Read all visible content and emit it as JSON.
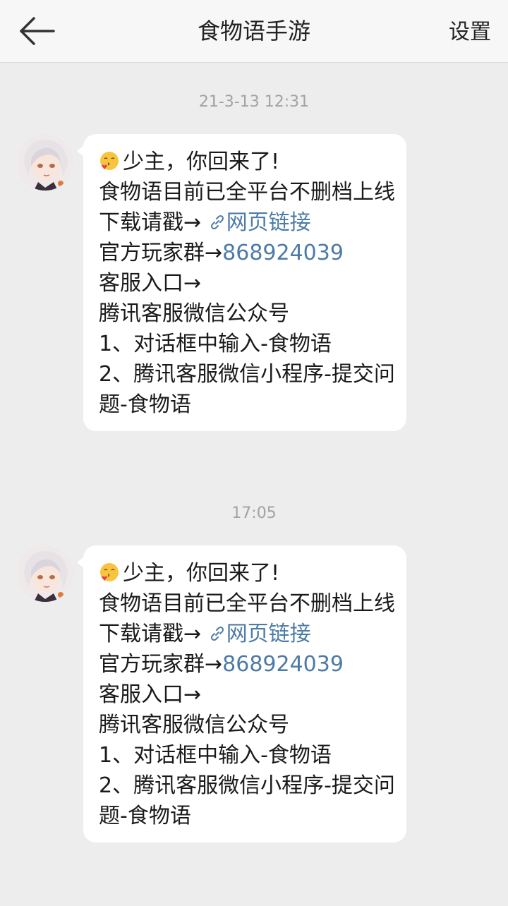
{
  "header": {
    "title": "食物语手游",
    "settings_label": "设置"
  },
  "messages": [
    {
      "timestamp": "21-3-13 12:31",
      "greeting": "少主，你回来了!",
      "line2": "食物语目前已全平台不删档上线",
      "download_prefix": "下载请戳→",
      "download_link": "网页链接",
      "group_prefix": "官方玩家群→",
      "group_number": "868924039",
      "service_entry": "客服入口→",
      "service_name": "腾讯客服微信公众号",
      "step1": "1、对话框中输入-食物语",
      "step2": "2、腾讯客服微信小程序-提交问题-食物语"
    },
    {
      "timestamp": "17:05",
      "greeting": "少主，你回来了!",
      "line2": "食物语目前已全平台不删档上线",
      "download_prefix": "下载请戳→",
      "download_link": "网页链接",
      "group_prefix": "官方玩家群→",
      "group_number": "868924039",
      "service_entry": "客服入口→",
      "service_name": "腾讯客服微信公众号",
      "step1": "1、对话框中输入-食物语",
      "step2": "2、腾讯客服微信小程序-提交问题-食物语"
    }
  ],
  "colors": {
    "link": "#4d7ba8",
    "background": "#ededed",
    "bubble": "#ffffff"
  },
  "icons": {
    "back": "back-arrow-icon",
    "emoji": "kiss-emoji-icon",
    "link": "link-icon"
  }
}
